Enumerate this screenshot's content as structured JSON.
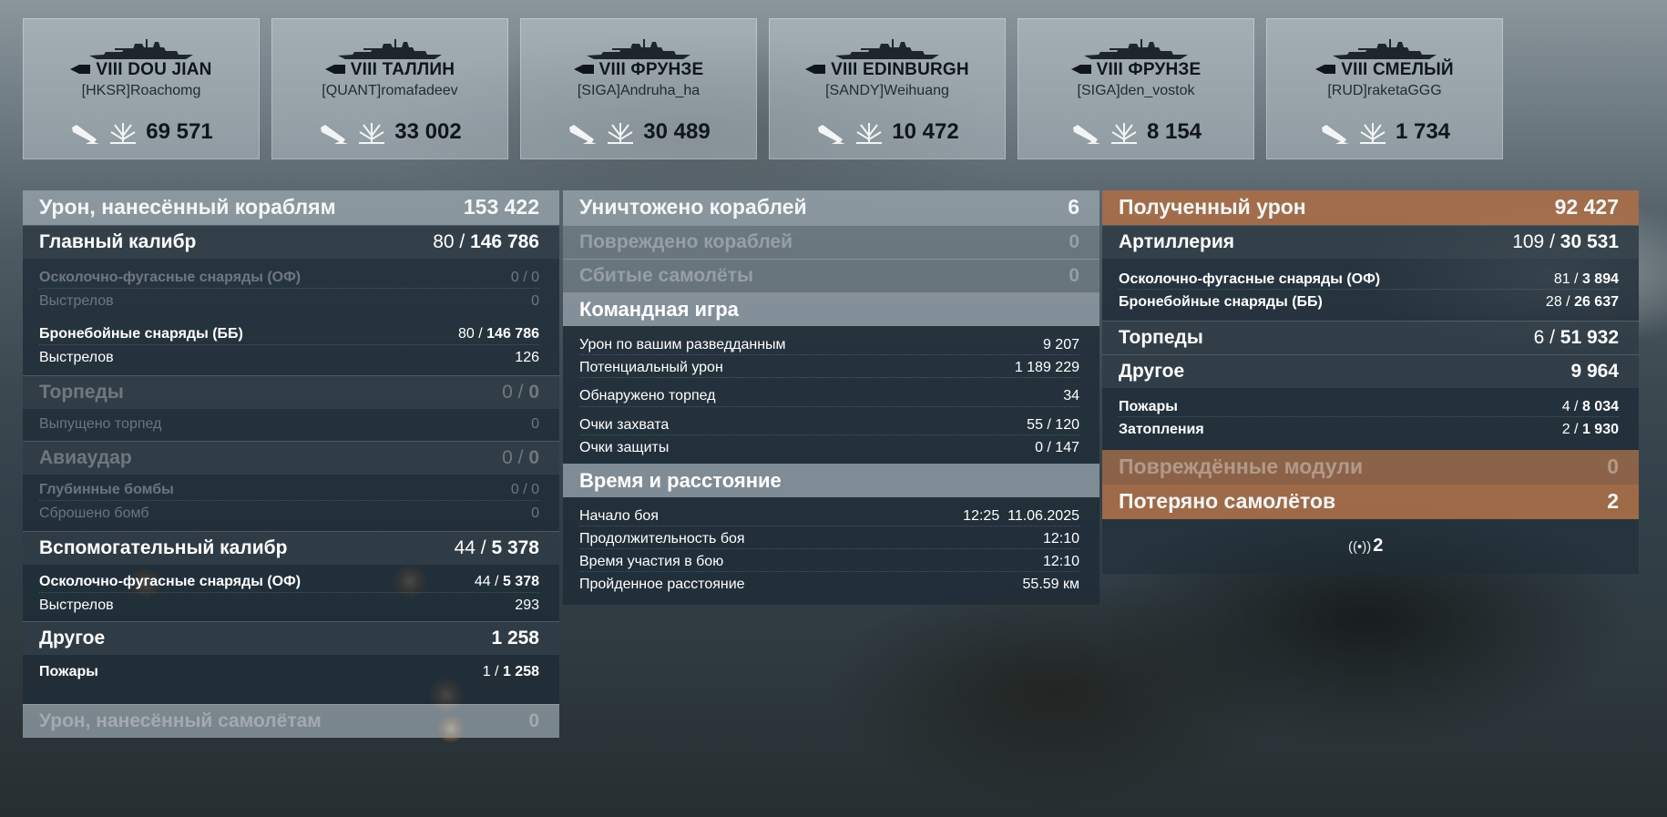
{
  "players": [
    {
      "tier": "VIII",
      "ship": "DOU JIAN",
      "player": "[HKSR]Roachomg",
      "damage": "69 571"
    },
    {
      "tier": "VIII",
      "ship": "ТАЛЛИН",
      "player": "[QUANT]romafadeev",
      "damage": "33 002"
    },
    {
      "tier": "VIII",
      "ship": "ФРУНЗЕ",
      "player": "[SIGA]Andruha_ha",
      "damage": "30 489"
    },
    {
      "tier": "VIII",
      "ship": "EDINBURGH",
      "player": "[SANDY]Weihuang",
      "damage": "10 472"
    },
    {
      "tier": "VIII",
      "ship": "ФРУНЗЕ",
      "player": "[SIGA]den_vostok",
      "damage": "8 154"
    },
    {
      "tier": "VIII",
      "ship": "СМЕЛЫЙ",
      "player": "[RUD]raketaGGG",
      "damage": "1 734"
    }
  ],
  "left": {
    "header": {
      "label": "Урон, нанесённый кораблям",
      "value": "153 422"
    },
    "main_caliber": {
      "label": "Главный калибр",
      "hits": "80",
      "value": "146 786"
    },
    "he_main": {
      "label": "Осколочно-фугасные снаряды (ОФ)",
      "value": "0 / 0"
    },
    "he_main_shots": {
      "label": "Выстрелов",
      "value": "0"
    },
    "ap_main": {
      "label": "Бронебойные снаряды (ББ)",
      "hits": "80",
      "value": "146 786"
    },
    "ap_main_shots": {
      "label": "Выстрелов",
      "value": "126"
    },
    "torpedoes": {
      "label": "Торпеды",
      "hits": "0",
      "value": "0"
    },
    "torp_launched": {
      "label": "Выпущено торпед",
      "value": "0"
    },
    "airstrike": {
      "label": "Авиаудар",
      "hits": "0",
      "value": "0"
    },
    "depth_charges": {
      "label": "Глубинные бомбы",
      "value": "0 / 0"
    },
    "bombs_dropped": {
      "label": "Сброшено бомб",
      "value": "0"
    },
    "secondary": {
      "label": "Вспомогательный калибр",
      "hits": "44",
      "value": "5 378"
    },
    "he_sec": {
      "label": "Осколочно-фугасные снаряды (ОФ)",
      "hits": "44",
      "value": "5 378"
    },
    "sec_shots": {
      "label": "Выстрелов",
      "value": "293"
    },
    "other": {
      "label": "Другое",
      "value": "1 258"
    },
    "fires": {
      "label": "Пожары",
      "hits": "1",
      "value": "1 258"
    },
    "aircraft_damage": {
      "label": "Урон, нанесённый самолётам",
      "value": "0"
    }
  },
  "middle": {
    "destroyed": {
      "label": "Уничтожено кораблей",
      "value": "6"
    },
    "damaged": {
      "label": "Повреждено кораблей",
      "value": "0"
    },
    "planes_shot": {
      "label": "Сбитые самолёты",
      "value": "0"
    },
    "teamplay": {
      "label": "Командная игра"
    },
    "spotting_damage": {
      "label": "Урон по вашим разведданным",
      "value": "9 207"
    },
    "potential_damage": {
      "label": "Потенциальный урон",
      "value": "1 189 229"
    },
    "torps_spotted": {
      "label": "Обнаружено торпед",
      "value": "34"
    },
    "capture_points": {
      "label": "Очки захвата",
      "value": "55 / 120"
    },
    "defense_points": {
      "label": "Очки защиты",
      "value": "0 / 147"
    },
    "time_distance": {
      "label": "Время и расстояние"
    },
    "battle_start": {
      "label": "Начало боя",
      "value": "12:25  11.06.2025"
    },
    "battle_duration": {
      "label": "Продолжительность боя",
      "value": "12:10"
    },
    "time_in_battle": {
      "label": "Время участия в бою",
      "value": "12:10"
    },
    "distance": {
      "label": "Пройденное расстояние",
      "value": "55.59 км"
    }
  },
  "right": {
    "received": {
      "label": "Полученный урон",
      "value": "92 427"
    },
    "artillery": {
      "label": "Артиллерия",
      "hits": "109",
      "value": "30 531"
    },
    "he_recv": {
      "label": "Осколочно-фугасные снаряды (ОФ)",
      "hits": "81",
      "value": "3 894"
    },
    "ap_recv": {
      "label": "Бронебойные снаряды (ББ)",
      "hits": "28",
      "value": "26 637"
    },
    "torpedoes": {
      "label": "Торпеды",
      "hits": "6",
      "value": "51 932"
    },
    "other": {
      "label": "Другое",
      "value": "9 964"
    },
    "fires": {
      "label": "Пожары",
      "hits": "4",
      "value": "8 034"
    },
    "flooding": {
      "label": "Затопления",
      "hits": "2",
      "value": "1 930"
    },
    "modules": {
      "label": "Повреждённые модули",
      "value": "0"
    },
    "planes_lost": {
      "label": "Потеряно самолётов",
      "value": "2"
    },
    "spotted_count": "2"
  }
}
